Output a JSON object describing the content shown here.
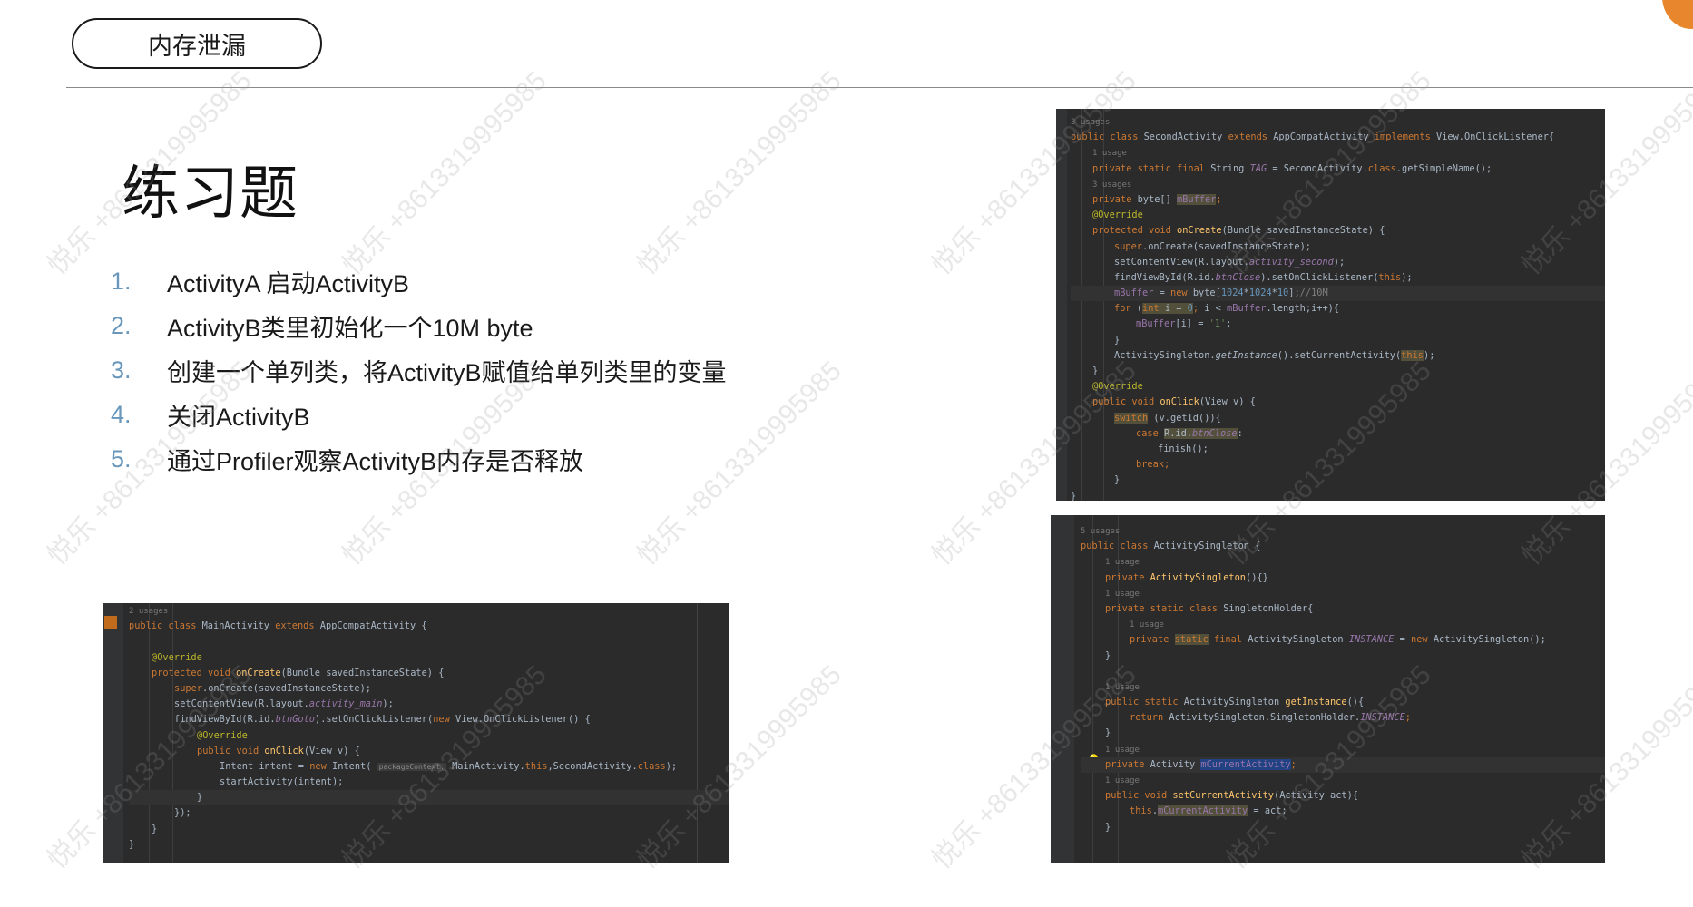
{
  "slide": {
    "tag": "内存泄漏",
    "heading": "练习题",
    "steps": [
      {
        "num": "1.",
        "text": "ActivityA 启动ActivityB"
      },
      {
        "num": "2.",
        "text": "ActivityB类里初始化一个10M byte"
      },
      {
        "num": "3.",
        "text": "创建一个单列类，将ActivityB赋值给单列类里的变量"
      },
      {
        "num": "4.",
        "text": "关闭ActivityB"
      },
      {
        "num": "5.",
        "text": "通过Profiler观察ActivityB内存是否释放"
      }
    ],
    "watermark": "悦乐 +8613319995985"
  },
  "code": {
    "second": [
      {
        "hint": "3 usages"
      },
      {
        "parts": [
          [
            "kw",
            "public class "
          ],
          [
            "",
            "SecondActivity "
          ],
          [
            "kw",
            "extends "
          ],
          [
            "",
            "AppCompatActivity "
          ],
          [
            "kw",
            "implements "
          ],
          [
            "",
            "View.OnClickListener{"
          ]
        ]
      },
      {
        "hint": "1 usage",
        "indent": 1
      },
      {
        "indent": 1,
        "parts": [
          [
            "kw",
            "private static final "
          ],
          [
            "",
            "String "
          ],
          [
            "field ital",
            "TAG"
          ],
          [
            "",
            " = SecondActivity."
          ],
          [
            "kw",
            "class"
          ],
          [
            "",
            ".getSimpleName();"
          ]
        ]
      },
      {
        "hint": "3 usages",
        "indent": 1
      },
      {
        "indent": 1,
        "parts": [
          [
            "kw",
            "private "
          ],
          [
            "",
            "byte[] "
          ],
          [
            "field hl-y",
            "mBuffer"
          ],
          [
            "kw",
            ";"
          ]
        ]
      },
      {
        "indent": 1,
        "parts": [
          [
            "ann",
            "@Override"
          ]
        ]
      },
      {
        "indent": 1,
        "parts": [
          [
            "kw",
            "protected void "
          ],
          [
            "fn",
            "onCreate"
          ],
          [
            "",
            "(Bundle savedInstanceState) {"
          ]
        ]
      },
      {
        "indent": 2,
        "parts": [
          [
            "kw",
            "super"
          ],
          [
            "",
            ".onCreate(savedInstanceState);"
          ]
        ]
      },
      {
        "indent": 2,
        "parts": [
          [
            "",
            "setContentView(R.layout."
          ],
          [
            "field ital",
            "activity_second"
          ],
          [
            "",
            ");"
          ]
        ]
      },
      {
        "indent": 2,
        "parts": [
          [
            "",
            "findViewById(R.id."
          ],
          [
            "field ital",
            "btnClose"
          ],
          [
            "",
            ").setOnClickListener("
          ],
          [
            "kw",
            "this"
          ],
          [
            "",
            ");"
          ]
        ]
      },
      {
        "indent": 2,
        "cur": true,
        "parts": [
          [
            "field",
            "mBuffer"
          ],
          [
            "",
            " = "
          ],
          [
            "kw",
            "new "
          ],
          [
            "",
            "byte["
          ],
          [
            "num",
            "1024"
          ],
          [
            "",
            "*"
          ],
          [
            "num",
            "1024"
          ],
          [
            "",
            "*"
          ],
          [
            "num",
            "10"
          ],
          [
            "",
            "];"
          ],
          [
            "cmt",
            "//10M"
          ]
        ]
      },
      {
        "indent": 2,
        "parts": [
          [
            "kw",
            "for "
          ],
          [
            "",
            "("
          ],
          [
            "kw hl-y",
            "int "
          ],
          [
            "hl-y",
            "i = "
          ],
          [
            "num hl-y",
            "0"
          ],
          [
            "kw",
            ";"
          ],
          [
            "",
            " i < "
          ],
          [
            "field",
            "mBuffer"
          ],
          [
            "",
            ".length;"
          ],
          [
            "",
            "i++){"
          ]
        ]
      },
      {
        "indent": 3,
        "parts": [
          [
            "field",
            "mBuffer"
          ],
          [
            "",
            "[i] = "
          ],
          [
            "str",
            "'1'"
          ],
          [
            "",
            ";"
          ]
        ]
      },
      {
        "indent": 2,
        "parts": [
          [
            "",
            "}"
          ]
        ]
      },
      {
        "indent": 2,
        "parts": [
          [
            "",
            "ActivitySingleton."
          ],
          [
            "ital",
            "getInstance"
          ],
          [
            "",
            "().setCurrentActivity("
          ],
          [
            "kw hl-y",
            "this"
          ],
          [
            "",
            ");"
          ]
        ]
      },
      {
        "indent": 1,
        "parts": [
          [
            "",
            "}"
          ]
        ]
      },
      {
        "indent": 1,
        "parts": [
          [
            "ann",
            "@Override"
          ]
        ]
      },
      {
        "indent": 1,
        "parts": [
          [
            "kw",
            "public void "
          ],
          [
            "fn",
            "onClick"
          ],
          [
            "",
            "(View v) {"
          ]
        ]
      },
      {
        "indent": 2,
        "parts": [
          [
            "kw hl-y",
            "switch"
          ],
          [
            "",
            " (v.getId()){"
          ]
        ]
      },
      {
        "indent": 3,
        "parts": [
          [
            "kw",
            "case "
          ],
          [
            "hl-y",
            "R.id."
          ],
          [
            "field ital hl-y",
            "btnClose"
          ],
          [
            "",
            ":"
          ]
        ]
      },
      {
        "indent": 4,
        "parts": [
          [
            "",
            "finish();"
          ]
        ]
      },
      {
        "indent": 3,
        "parts": [
          [
            "kw",
            "break;"
          ]
        ]
      },
      {
        "indent": 2,
        "parts": [
          [
            "",
            "}"
          ]
        ]
      },
      {
        "indent": 0,
        "parts": [
          [
            "",
            "}"
          ]
        ]
      }
    ],
    "singleton": [
      {
        "hint": "5 usages"
      },
      {
        "parts": [
          [
            "kw",
            "public class "
          ],
          [
            "",
            "ActivitySingleton {"
          ]
        ]
      },
      {
        "hint": "1 usage",
        "indent": 1
      },
      {
        "indent": 1,
        "parts": [
          [
            "kw",
            "private "
          ],
          [
            "fn",
            "ActivitySingleton"
          ],
          [
            "",
            "(){}"
          ]
        ]
      },
      {
        "hint": "1 usage",
        "indent": 1
      },
      {
        "indent": 1,
        "parts": [
          [
            "kw",
            "private static class "
          ],
          [
            "",
            "SingletonHolder{"
          ]
        ]
      },
      {
        "hint": "1 usage",
        "indent": 2
      },
      {
        "indent": 2,
        "parts": [
          [
            "kw",
            "private "
          ],
          [
            "kw hl-y",
            "static"
          ],
          [
            "kw",
            " final "
          ],
          [
            "",
            "ActivitySingleton "
          ],
          [
            "field ital",
            "INSTANCE"
          ],
          [
            "",
            " = "
          ],
          [
            "kw",
            "new "
          ],
          [
            "",
            "ActivitySingleton();"
          ]
        ]
      },
      {
        "indent": 1,
        "parts": [
          [
            "",
            "}"
          ]
        ]
      },
      {
        "parts": [
          [
            "",
            ""
          ]
        ]
      },
      {
        "hint": "1 usage",
        "indent": 1
      },
      {
        "indent": 1,
        "parts": [
          [
            "kw",
            "public static "
          ],
          [
            "",
            "ActivitySingleton "
          ],
          [
            "fn",
            "getInstance"
          ],
          [
            "",
            "(){"
          ]
        ]
      },
      {
        "indent": 2,
        "parts": [
          [
            "kw",
            "return "
          ],
          [
            "",
            "ActivitySingleton.SingletonHolder."
          ],
          [
            "field ital",
            "INSTANCE"
          ],
          [
            "kw",
            ";"
          ]
        ]
      },
      {
        "indent": 1,
        "parts": [
          [
            "",
            "}"
          ]
        ]
      },
      {
        "hint": "1 usage",
        "indent": 1
      },
      {
        "indent": 1,
        "cur": true,
        "parts": [
          [
            "kw",
            "private "
          ],
          [
            "",
            "Activity "
          ],
          [
            "field hl-b",
            "mCurrentActivity"
          ],
          [
            "kw",
            ";"
          ]
        ]
      },
      {
        "hint": "1 usage",
        "indent": 1
      },
      {
        "indent": 1,
        "parts": [
          [
            "kw",
            "public void "
          ],
          [
            "fn",
            "setCurrentActivity"
          ],
          [
            "",
            "(Activity act){"
          ]
        ]
      },
      {
        "indent": 2,
        "parts": [
          [
            "kw",
            "this"
          ],
          [
            "",
            "."
          ],
          [
            "field hl-y",
            "mCurrentActivity"
          ],
          [
            "",
            " = act;"
          ]
        ]
      },
      {
        "indent": 1,
        "parts": [
          [
            "",
            "}"
          ]
        ]
      }
    ],
    "main": [
      {
        "hint": "2 usages"
      },
      {
        "parts": [
          [
            "kw",
            "public class "
          ],
          [
            "",
            "MainActivity "
          ],
          [
            "kw",
            "extends "
          ],
          [
            "",
            "AppCompatActivity {"
          ]
        ]
      },
      {
        "parts": [
          [
            "",
            ""
          ]
        ]
      },
      {
        "indent": 1,
        "parts": [
          [
            "ann",
            "@Override"
          ]
        ]
      },
      {
        "indent": 1,
        "parts": [
          [
            "kw",
            "protected void "
          ],
          [
            "fn",
            "onCreate"
          ],
          [
            "",
            "(Bundle savedInstanceState) {"
          ]
        ]
      },
      {
        "indent": 2,
        "parts": [
          [
            "kw",
            "super"
          ],
          [
            "",
            ".onCreate(savedInstanceState);"
          ]
        ]
      },
      {
        "indent": 2,
        "parts": [
          [
            "",
            "setContentView(R.layout."
          ],
          [
            "field ital",
            "activity_main"
          ],
          [
            "",
            ");"
          ]
        ]
      },
      {
        "indent": 2,
        "parts": [
          [
            "",
            "findViewById(R.id."
          ],
          [
            "field ital",
            "btnGoto"
          ],
          [
            "",
            ").setOnClickListener("
          ],
          [
            "kw",
            "new "
          ],
          [
            "",
            "View.OnClickListener() {"
          ]
        ]
      },
      {
        "indent": 3,
        "parts": [
          [
            "ann",
            "@Override"
          ]
        ]
      },
      {
        "indent": 3,
        "parts": [
          [
            "kw",
            "public void "
          ],
          [
            "fn",
            "onClick"
          ],
          [
            "",
            "(View v) {"
          ]
        ]
      },
      {
        "indent": 4,
        "parts": [
          [
            "",
            "Intent intent = "
          ],
          [
            "kw",
            "new "
          ],
          [
            "",
            "Intent( "
          ],
          [
            "inlay",
            "packageContext:"
          ],
          [
            "",
            " MainActivity."
          ],
          [
            "kw",
            "this"
          ],
          [
            "",
            ",SecondActivity."
          ],
          [
            "kw",
            "class"
          ],
          [
            "",
            ");"
          ]
        ]
      },
      {
        "indent": 4,
        "parts": [
          [
            "",
            "startActivity(intent);"
          ]
        ]
      },
      {
        "indent": 3,
        "cur": true,
        "parts": [
          [
            "",
            "}"
          ]
        ]
      },
      {
        "indent": 2,
        "parts": [
          [
            "",
            "});"
          ]
        ]
      },
      {
        "indent": 1,
        "parts": [
          [
            "",
            "}"
          ]
        ]
      },
      {
        "parts": [
          [
            "",
            "}"
          ]
        ]
      }
    ]
  }
}
